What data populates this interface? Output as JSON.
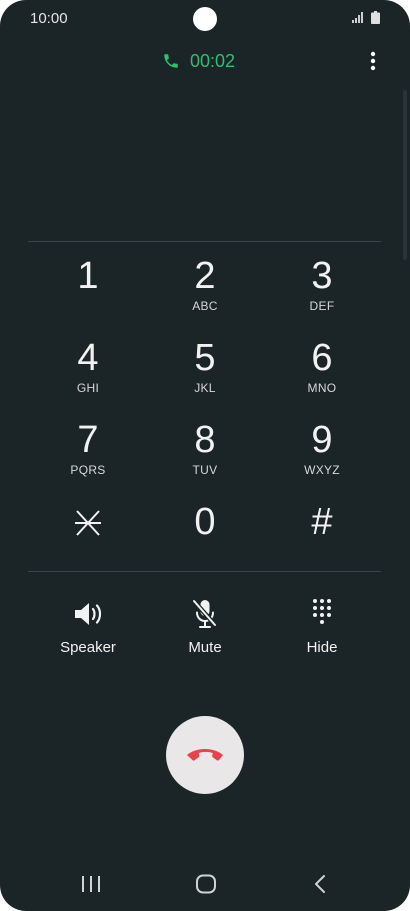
{
  "status_bar": {
    "time": "10:00"
  },
  "call": {
    "duration": "00:02"
  },
  "dialpad": [
    {
      "digit": "1",
      "letters": ""
    },
    {
      "digit": "2",
      "letters": "ABC"
    },
    {
      "digit": "3",
      "letters": "DEF"
    },
    {
      "digit": "4",
      "letters": "GHI"
    },
    {
      "digit": "5",
      "letters": "JKL"
    },
    {
      "digit": "6",
      "letters": "MNO"
    },
    {
      "digit": "7",
      "letters": "PQRS"
    },
    {
      "digit": "8",
      "letters": "TUV"
    },
    {
      "digit": "9",
      "letters": "WXYZ"
    },
    {
      "digit": "",
      "letters": ""
    },
    {
      "digit": "0",
      "letters": ""
    },
    {
      "digit": "#",
      "letters": ""
    }
  ],
  "controls": {
    "speaker": "Speaker",
    "mute": "Mute",
    "hide": "Hide"
  },
  "colors": {
    "background": "#1b2427",
    "accent_green": "#2fbf71",
    "end_call_red": "#e8424b",
    "end_call_bg": "#e9e7e7"
  },
  "icons": {
    "call": "phone-icon",
    "more": "more-vert-icon",
    "star": "asterisk-icon",
    "speaker": "speaker-icon",
    "mute": "mic-off-icon",
    "hide": "dialpad-icon",
    "end_call": "phone-hangup-icon",
    "recents": "recents-icon",
    "home": "home-icon",
    "back": "back-icon"
  }
}
